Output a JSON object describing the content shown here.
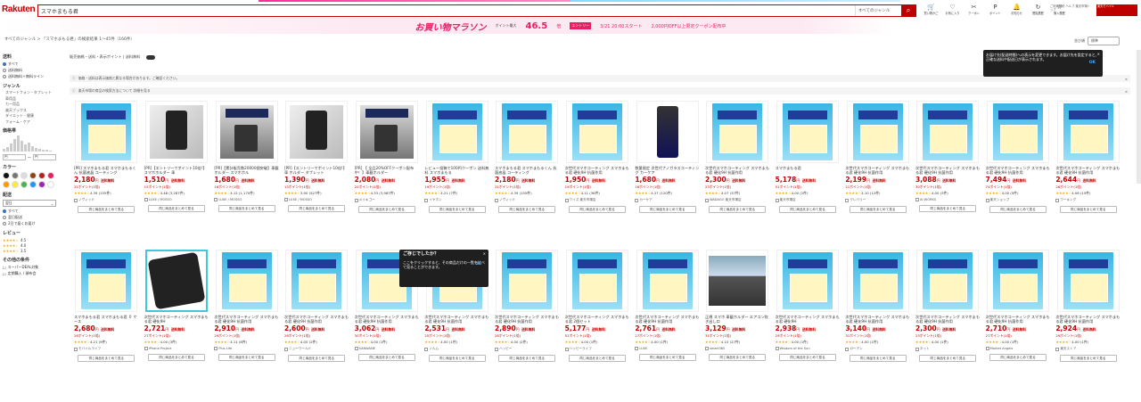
{
  "header": {
    "logo": "Rakuten",
    "search_value": "スマホまもる君",
    "search_scope": "すべてのジャンル",
    "icons": [
      {
        "name": "cart-icon",
        "g": "🛒",
        "label": "買い物かご"
      },
      {
        "name": "favorite-icon",
        "g": "♡",
        "label": "お気に入り"
      },
      {
        "name": "coupon-icon",
        "g": "✂",
        "label": "クーポン"
      },
      {
        "name": "point-icon",
        "g": "P",
        "label": "ポイント"
      },
      {
        "name": "bell-icon",
        "g": "🔔",
        "label": "お知らせ"
      },
      {
        "name": "history-icon",
        "g": "↻",
        "label": "閲覧履歴"
      },
      {
        "name": "star-icon",
        "g": "☆",
        "label": "購入履歴"
      }
    ],
    "right_text": "ご利用規約 ヘルプ 楽天市場トップ",
    "promo": "楽天モバイル"
  },
  "banner": {
    "title": "お買い物マラソン",
    "caption": "ポイント最大",
    "number": "46.5",
    "unit": "倍",
    "tag": "エントリー",
    "when": "3/21 20:00スタート",
    "sub": "2,000円OFF以上限定クーポン配布中"
  },
  "breadcrumb": "すべてのジャンル > 「スマホまもる君」の検索結果 1〜45件（166件）",
  "sort": {
    "label": "並び順",
    "value": "標準",
    "view": "表示"
  },
  "filter_bar": "販売価格・送料・表示ポイント | 送料無料",
  "notices": [
    "価格・送料は表示価格と異なる場合があります。ご確認ください。",
    "楽天市場の商品の検索方法について 詳細を見る"
  ],
  "sidebar": {
    "shipping_h": "送料",
    "shipping": [
      "すべて",
      "送料無料",
      "送料無料＋無料ライン"
    ],
    "genre_h": "ジャンル",
    "genres": [
      "スマートフォン・タブレット",
      "車用品",
      "カー用品",
      "楽天ブックス",
      "ダイエット・健康",
      "フォーム・ケア"
    ],
    "price_h": "価格帯",
    "price_min": "円",
    "price_max": "円",
    "color_h": "カラー",
    "colors": [
      "#111111",
      "#777777",
      "#dddddd",
      "#8b4513",
      "#b22222",
      "#e91e63",
      "#ff9800",
      "#ffeb3b",
      "#4caf50",
      "#2196f3",
      "#9c27b0",
      "#ffffff"
    ],
    "delivery_h": "配送",
    "delivery_value": "翌日",
    "delivery_opts": [
      "すべて",
      "翌日配送",
      "2日で届くお届け"
    ],
    "review_h": "レビュー",
    "reviews": [
      "4.5",
      "4.0",
      "3.5"
    ],
    "other_h": "その他の条件",
    "other": [
      "スーパーDEAL対象",
      "定期購入 / 頒布会"
    ]
  },
  "card_button": "同じ商品をまとめて見る",
  "products": [
    {
      "img": "pk",
      "title": "[PR] スマホまもる君 スマホまもるくん 抗菌液晶 コーティング",
      "price": "2,180",
      "pt": "21ポイント(1倍)",
      "stars": "★★★★☆",
      "rev": "4.39 (155件)",
      "shop": "ノヴィッド"
    },
    {
      "img": "ph",
      "title": "[PR]【エントリーでポイント10倍!】スマホホルダー 車",
      "price": "1,510",
      "pt": "15ポイント(1倍)",
      "stars": "★★★★☆",
      "rev": "4.48 (3,287件)",
      "shop": "LUXE / MOSSO"
    },
    {
      "img": "phd",
      "title": "[PR]【累計販売数20000個突破】車載ホルダー スマホホル",
      "price": "1,680",
      "pt": "16ポイント(1倍)",
      "stars": "★★★★☆",
      "rev": "4.12 (1,170件)",
      "shop": "LUXE / MOSSO"
    },
    {
      "img": "ph",
      "title": "[PR]【エントリーでポイント10倍!】 車 ホルダー タブレット",
      "price": "1,390",
      "pt": "13ポイント(1倍)",
      "stars": "★★★★☆",
      "rev": "3.90 (527件)",
      "shop": "LUXE / MOSSO"
    },
    {
      "img": "phd",
      "title": "[PR] 【 全品20%OFFクーポン配布中！】車載ホルダー",
      "price": "2,080",
      "pt": "20ポイント(1倍)",
      "stars": "★★★★☆",
      "rev": "4.33 (3,987件)",
      "shop": "メイキゴー"
    },
    {
      "img": "pk",
      "title": "レビュー投稿で100円クーポン 送料無料 スマホまもる",
      "price": "1,955",
      "pt": "19ポイント(1倍)",
      "stars": "★★★★☆",
      "rev": "4.21 (7件)",
      "shop": "イヤホン"
    },
    {
      "img": "pk",
      "title": "スマホまもる君 スマホまもるくん 抗菌液晶 コーティング",
      "price": "2,180",
      "pt": "21ポイント(1倍)",
      "stars": "★★★★☆",
      "rev": "4.39 (155件)",
      "shop": "ノヴィッド"
    },
    {
      "img": "pk",
      "title": "次世代スマホコーティング スマホまもる君 硬化9H 抗菌作用",
      "price": "1,950",
      "pt": "19ポイント(1倍)",
      "stars": "★★★★☆",
      "rev": "4.11 (36件)",
      "shop": "ワイズ 楽天市場店"
    },
    {
      "img": "sp",
      "title": "数量限定 次世代ナノガラスコーティング カーケア",
      "price": "1,680",
      "pt": "16ポイント(1倍)",
      "stars": "★★★★☆",
      "rev": "4.27 (120件)",
      "shop": "カーケア"
    },
    {
      "img": "pk",
      "title": "次世代スマホコーティング スマホまもる君 硬化9H 抗菌作用",
      "price": "2,300",
      "pt": "23ポイント(1倍)",
      "stars": "★★★★☆",
      "rev": "4.07 (37件)",
      "shop": "WADAGO 楽天市場店"
    },
    {
      "img": "pk",
      "title": "スマホまもる君",
      "price": "5,178",
      "pt": "51ポイント(1倍)",
      "stars": "★★★★☆",
      "rev": "4.00 (2件)",
      "shop": "楽天市場店"
    },
    {
      "img": "pk",
      "title": "次世代スマホコーティング スマホまもる君 硬化9H 抗菌作用",
      "price": "2,199",
      "pt": "21ポイント(1倍)",
      "stars": "★★★★☆",
      "rev": "4.10 (12件)",
      "shop": "クレバリー"
    },
    {
      "img": "pk",
      "title": "次世代スマホコーティング スマホまもる君 硬化9H 抗菌作用",
      "price": "3,088",
      "pt": "30ポイント(1倍)",
      "stars": "★★★★☆",
      "rev": "4.00 (3件)",
      "shop": "AI WORKS"
    },
    {
      "img": "pk",
      "title": "次世代スマホコーティング スマホまもる君 硬化9H 抗菌作用",
      "price": "7,494",
      "pt": "74ポイント(1倍)",
      "stars": "★★★★☆",
      "rev": "4.00 (5件)",
      "shop": "楽天ショップ"
    },
    {
      "img": "pk",
      "title": "次世代スマホコーティング スマホまもる君 硬化9H 抗菌作用",
      "price": "2,644",
      "pt": "26ポイント(1倍)",
      "stars": "★★★★☆",
      "rev": "4.06 (15件)",
      "shop": "ワーキング"
    },
    {
      "img": "pk",
      "title": "スマホまもる君 スマホまもる君 ０ ケース",
      "price": "2,680",
      "pt": "26ポイント(1倍)",
      "stars": "★★★★☆",
      "rev": "4.21 (9件)",
      "shop": "モバイルライフ"
    },
    {
      "img": "chg",
      "title": "次世代スマホコーティング スマホまもる君 硬化9H",
      "price": "2,721",
      "pt": "27ポイント(1倍)",
      "stars": "★★★★☆",
      "rev": "4.00 (3件)",
      "shop": "iPhone Project"
    },
    {
      "img": "pk",
      "title": "次世代スマホコーティング スマホまもる君 硬化9H 抗菌作用",
      "price": "2,910",
      "pt": "29ポイント(1倍)",
      "stars": "★★★★☆",
      "rev": "4.11 (8件)",
      "shop": "Plus Life"
    },
    {
      "img": "pk",
      "title": "次世代スマホコーティング スマホまもる君 硬化9H 抗菌作用",
      "price": "2,600",
      "pt": "26ポイント(1倍)",
      "stars": "★★★★☆",
      "rev": "4.00 (2件)",
      "shop": "ニューワールド"
    },
    {
      "img": "pk",
      "title": "次世代スマホコーティング スマホまもる君 硬化9H 抗菌作用",
      "price": "3,062",
      "pt": "30ポイント(1倍)",
      "stars": "★★★★☆",
      "rev": "4.00 (1件)",
      "shop": "SANWANE"
    },
    {
      "img": "pk",
      "title": "次世代スマホコーティング スマホまもる君 硬化9H 抗菌作用",
      "price": "2,531",
      "pt": "25ポイント(1倍)",
      "stars": "★★★★☆",
      "rev": "4.00 (1件)",
      "shop": "ノルム"
    },
    {
      "img": "pk",
      "title": "次世代スマホコーティング スマホまもる君 硬化9H 抗菌作用",
      "price": "2,890",
      "pt": "28ポイント(1倍)",
      "stars": "★★★★☆",
      "rev": "4.00 (2件)",
      "shop": "ハッピー"
    },
    {
      "img": "pk",
      "title": "次世代スマホコーティング スマホまもる君 2個セット",
      "price": "5,177",
      "pt": "51ポイント(1倍)",
      "stars": "★★★★☆",
      "rev": "4.00 (1件)",
      "shop": "ハッピーライフ"
    },
    {
      "img": "pk",
      "title": "次世代スマホコーティング スマホまもる君 硬化9H 抗菌作用",
      "price": "2,761",
      "pt": "27ポイント(1倍)",
      "stars": "★★★★☆",
      "rev": "4.00 (1件)",
      "shop": "LUXE"
    },
    {
      "img": "car",
      "title": "正規 スマホ 車載ホルダー エアコン吹き出し口",
      "price": "3,129",
      "pt": "31ポイント(1倍)",
      "stars": "★★★★☆",
      "rev": "4.10 (27件)",
      "shop": "smart365"
    },
    {
      "img": "pk",
      "title": "次世代スマホコーティング スマホまもる君 硬化9H",
      "price": "2,938",
      "pt": "29ポイント(1倍)",
      "stars": "★★★★☆",
      "rev": "4.00 (1件)",
      "shop": "Wisdom of the Sun"
    },
    {
      "img": "pk",
      "title": "次世代スマホコーティング スマホまもる君 硬化9H 抗菌作用",
      "price": "3,140",
      "pt": "31ポイント(1倍)",
      "stars": "★★★★☆",
      "rev": "4.00 (1件)",
      "shop": "ガーデン"
    },
    {
      "img": "pk",
      "title": "次世代スマホコーティング スマホまもる君 硬化9H 抗菌作用",
      "price": "2,300",
      "pt": "23ポイント(1倍)",
      "stars": "★★★★☆",
      "rev": "4.00 (1件)",
      "shop": "ネット"
    },
    {
      "img": "pk",
      "title": "次世代スマホコーティング スマホまもる君 硬化9H 抗菌作用",
      "price": "2,710",
      "pt": "27ポイント(1倍)",
      "stars": "★★★★☆",
      "rev": "4.00 (1件)",
      "shop": "Market Angels"
    },
    {
      "img": "pk",
      "title": "次世代スマホコーティング スマホまもる君 硬化9H 抗菌作用",
      "price": "2,924",
      "pt": "29ポイント(1倍)",
      "stars": "★★★★☆",
      "rev": "4.00 (1件)",
      "shop": "楽天ストア"
    }
  ],
  "tooltip_top": {
    "text": "お届け先(配送時間)への表示を変更できます。お届け先を設定すると、正確な送料や配送日が表示されます。",
    "ok": "OK",
    "close": "×"
  },
  "tooltip_mid": {
    "title": "ご存じでしたか？",
    "text": "ここをクリックすると、その商品だけの一覧を比べて見ることができます。",
    "ok": "OK",
    "close": "×"
  },
  "price_unit": "円",
  "ship_label": "送料無料"
}
